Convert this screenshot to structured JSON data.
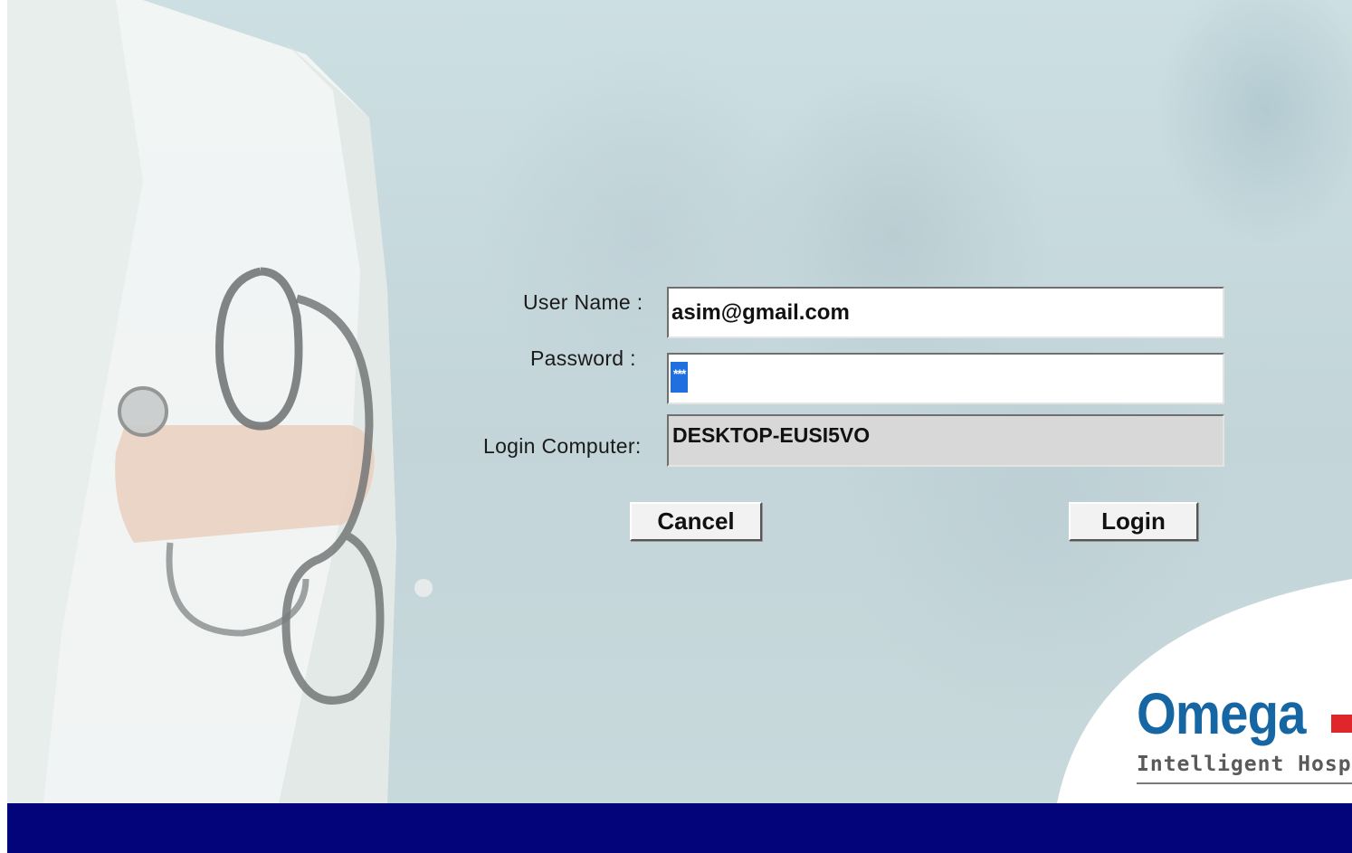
{
  "form": {
    "username_label": "User Name :",
    "username_value": "asim@gmail.com",
    "password_label": "Password :",
    "password_mask": "***",
    "computer_label": "Login Computer:",
    "computer_value": "DESKTOP-EUSI5VO"
  },
  "buttons": {
    "cancel": "Cancel",
    "login": "Login"
  },
  "branding": {
    "logo_text": "Omega",
    "tagline": "Intelligent Hosp",
    "logo_color": "#1766a4",
    "accent_color": "#e0262b"
  },
  "footer": {
    "bar_color": "#03037a"
  }
}
